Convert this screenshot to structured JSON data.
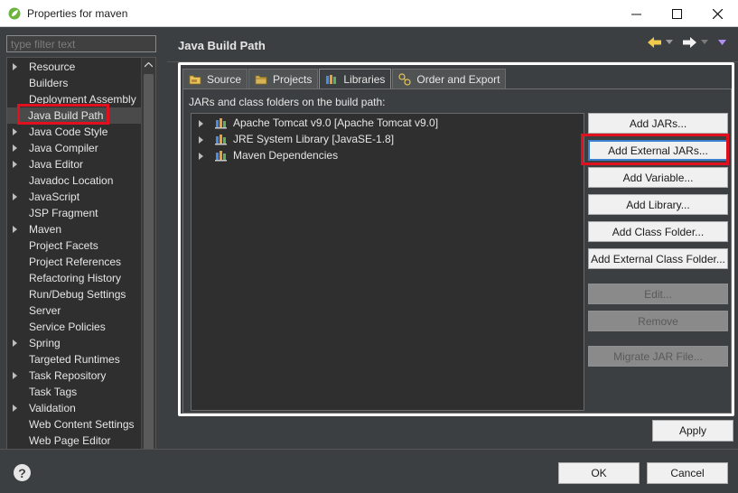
{
  "window": {
    "title": "Properties for maven",
    "controls": {
      "minimize": "–",
      "maximize": "□",
      "close": "✕"
    }
  },
  "filter": {
    "placeholder": "type filter text"
  },
  "tree": {
    "items": [
      {
        "label": "Resource",
        "expandable": true
      },
      {
        "label": "Builders",
        "expandable": false
      },
      {
        "label": "Deployment Assembly",
        "expandable": false
      },
      {
        "label": "Java Build Path",
        "expandable": false,
        "selected": true
      },
      {
        "label": "Java Code Style",
        "expandable": true
      },
      {
        "label": "Java Compiler",
        "expandable": true
      },
      {
        "label": "Java Editor",
        "expandable": true
      },
      {
        "label": "Javadoc Location",
        "expandable": false
      },
      {
        "label": "JavaScript",
        "expandable": true
      },
      {
        "label": "JSP Fragment",
        "expandable": false
      },
      {
        "label": "Maven",
        "expandable": true
      },
      {
        "label": "Project Facets",
        "expandable": false
      },
      {
        "label": "Project References",
        "expandable": false
      },
      {
        "label": "Refactoring History",
        "expandable": false
      },
      {
        "label": "Run/Debug Settings",
        "expandable": false
      },
      {
        "label": "Server",
        "expandable": false
      },
      {
        "label": "Service Policies",
        "expandable": false
      },
      {
        "label": "Spring",
        "expandable": true
      },
      {
        "label": "Targeted Runtimes",
        "expandable": false
      },
      {
        "label": "Task Repository",
        "expandable": true
      },
      {
        "label": "Task Tags",
        "expandable": false
      },
      {
        "label": "Validation",
        "expandable": true
      },
      {
        "label": "Web Content Settings",
        "expandable": false
      },
      {
        "label": "Web Page Editor",
        "expandable": false
      }
    ]
  },
  "header": {
    "title": "Java Build Path"
  },
  "tabs": [
    {
      "label": "Source",
      "icon": "source-folder-icon"
    },
    {
      "label": "Projects",
      "icon": "projects-icon"
    },
    {
      "label": "Libraries",
      "icon": "libraries-icon",
      "active": true
    },
    {
      "label": "Order and Export",
      "icon": "order-export-icon"
    }
  ],
  "libraries": {
    "section_label": "JARs and class folders on the build path:",
    "entries": [
      {
        "label": "Apache Tomcat v9.0 [Apache Tomcat v9.0]",
        "icon": "library-icon"
      },
      {
        "label": "JRE System Library [JavaSE-1.8]",
        "icon": "library-icon"
      },
      {
        "label": "Maven Dependencies",
        "icon": "library-icon"
      }
    ]
  },
  "buttons": {
    "add_jars": "Add JARs...",
    "add_external_jars": "Add External JARs...",
    "add_variable": "Add Variable...",
    "add_library": "Add Library...",
    "add_class_folder": "Add Class Folder...",
    "add_external_class_folder": "Add External Class Folder...",
    "edit": "Edit...",
    "remove": "Remove",
    "migrate_jar": "Migrate JAR File...",
    "apply": "Apply",
    "ok": "OK",
    "cancel": "Cancel"
  },
  "colors": {
    "highlight": "#e0101e",
    "accent": "#3b7fd0",
    "background": "#3c3f41"
  }
}
